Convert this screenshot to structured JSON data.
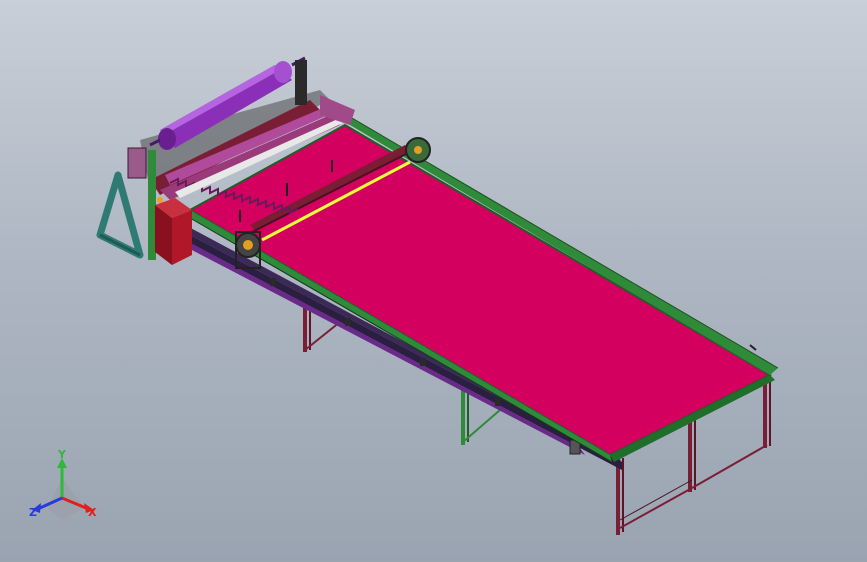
{
  "colors": {
    "background_top": "#c9cfd8",
    "background_bottom": "#9aa4b1",
    "table_surface": "#d4005f",
    "frame_green": "#2f8a3a",
    "leg_maroon": "#7a1e35",
    "roll_purple": "#8b2fb8",
    "laser_line": "#e8ff3a",
    "cabinet_red": "#b0182a",
    "stand_teal": "#2f7a73",
    "axis_x": "#e0201c",
    "axis_y": "#2fb83a",
    "axis_z": "#2a3ad8"
  },
  "triad": {
    "x_label": "X",
    "y_label": "Y",
    "z_label": "Z"
  }
}
